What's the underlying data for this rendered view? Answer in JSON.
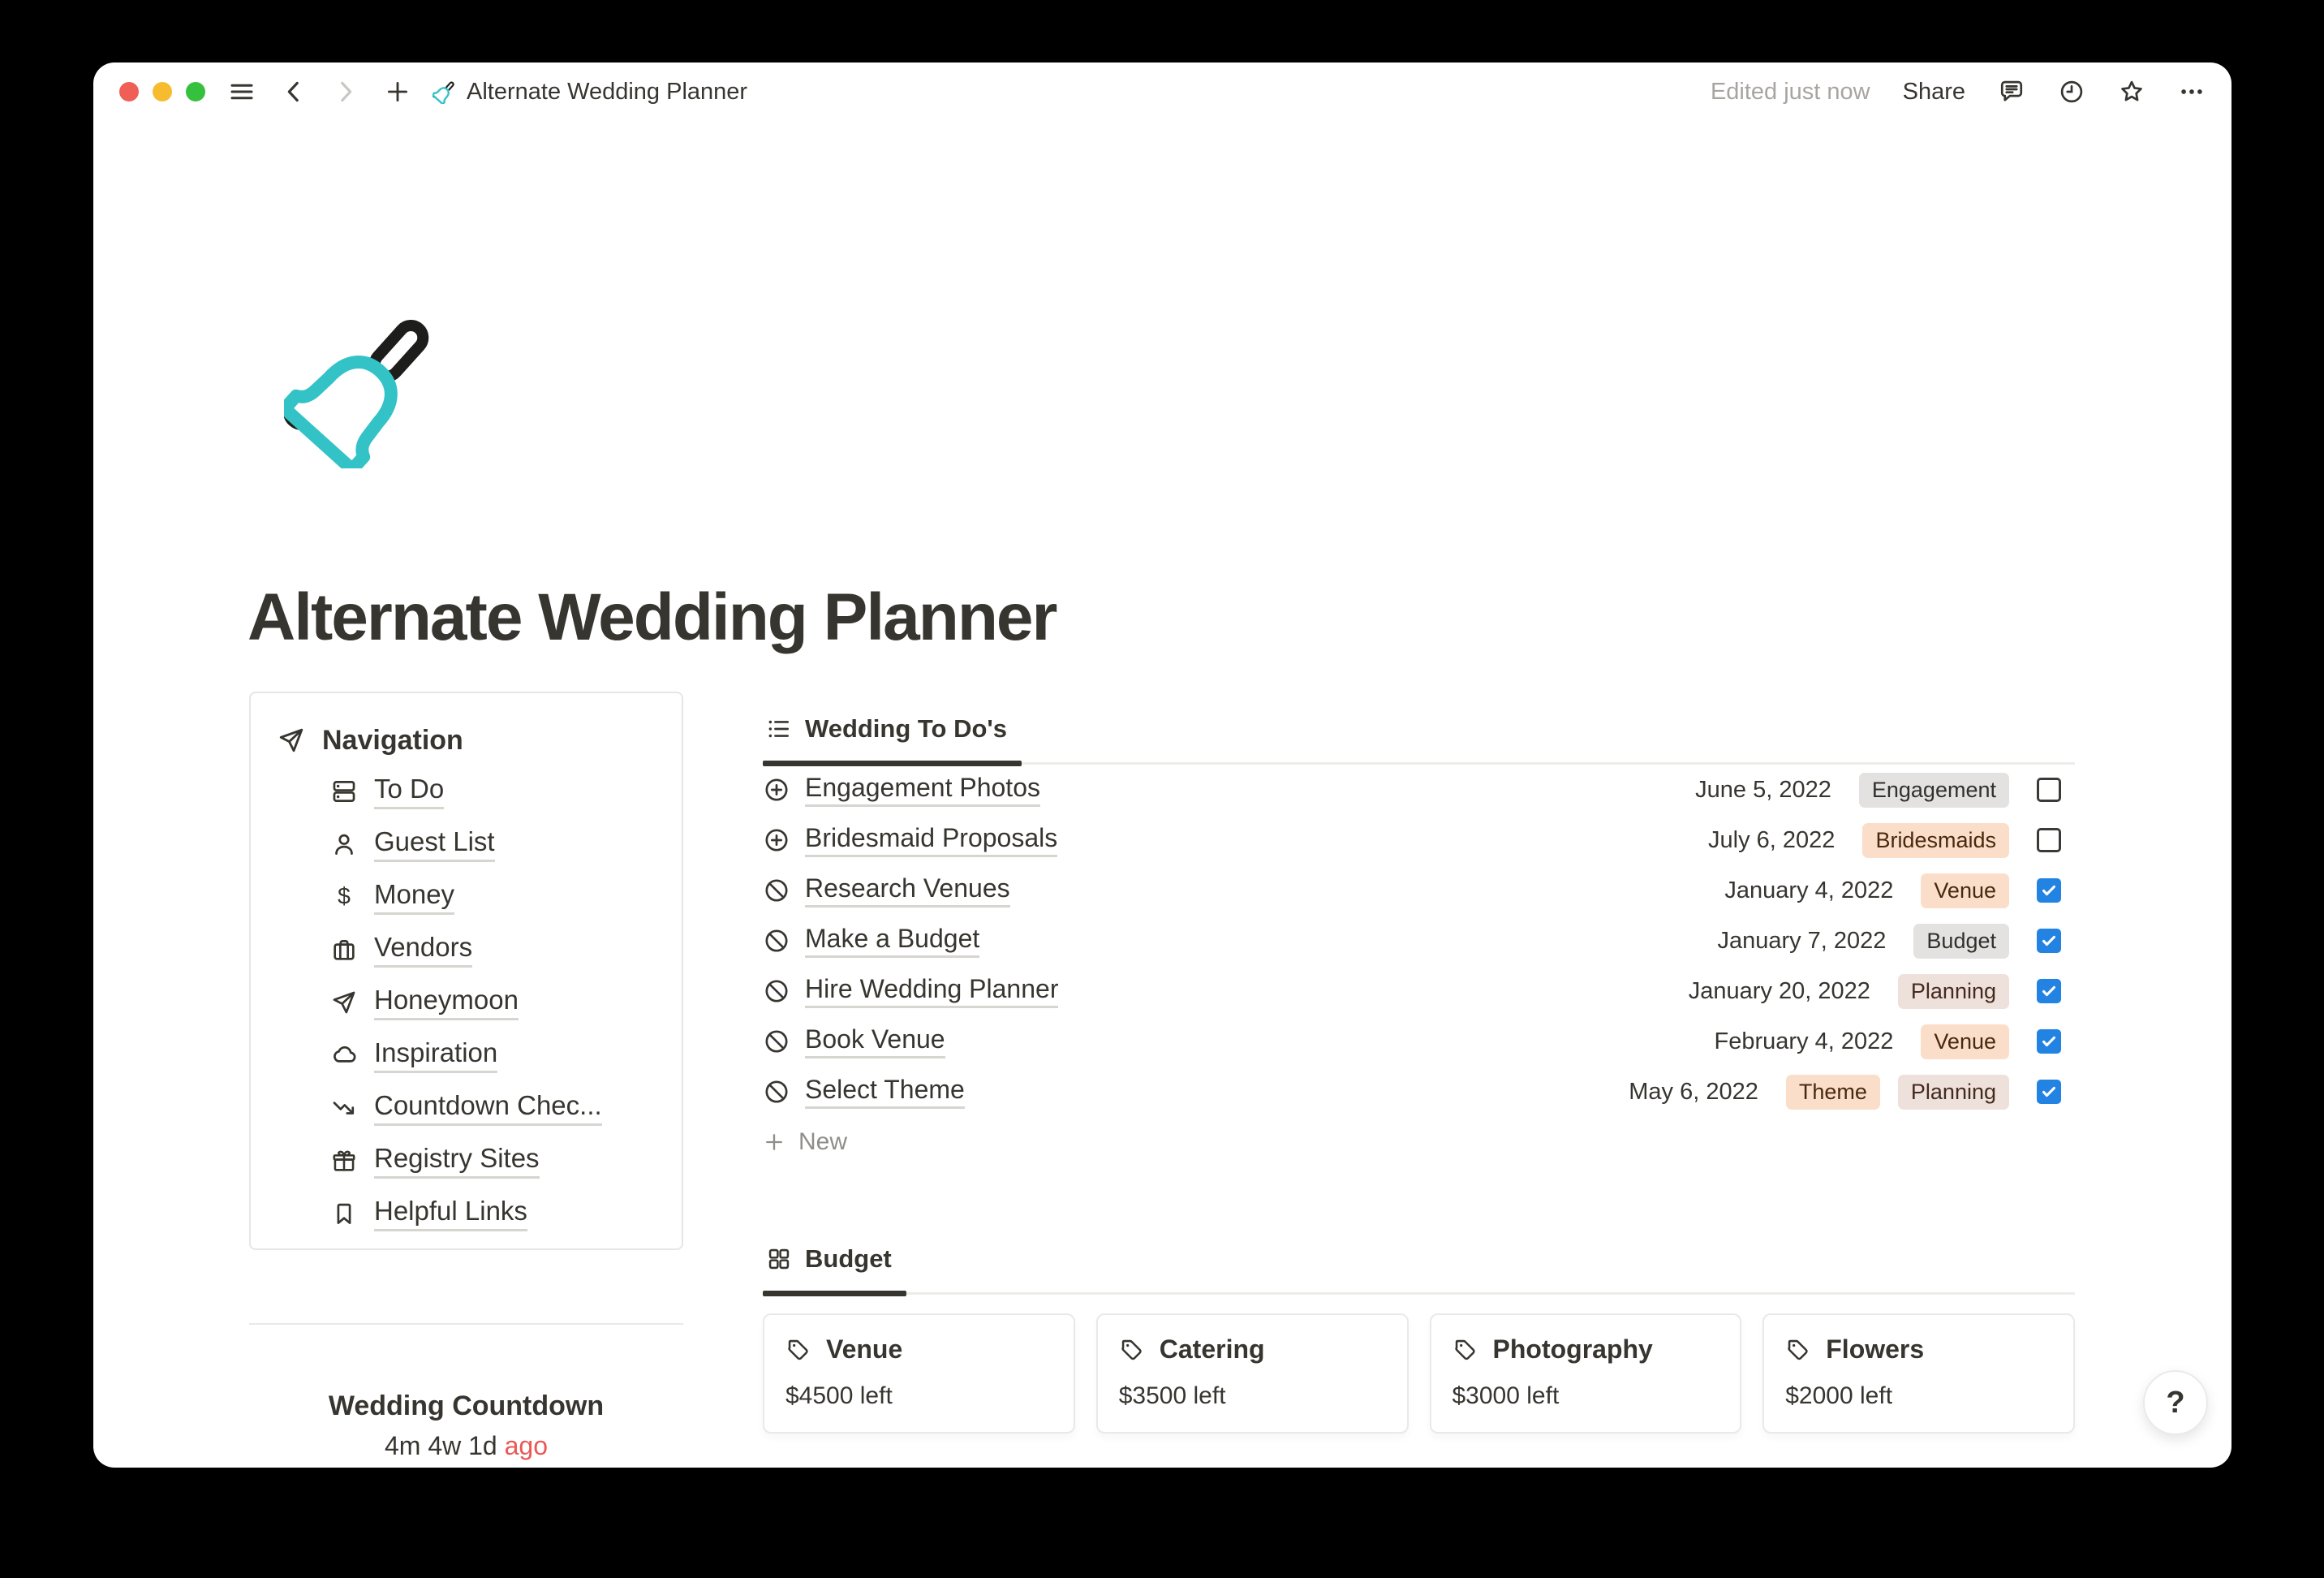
{
  "titlebar": {
    "title": "Alternate Wedding Planner",
    "edited_status": "Edited just now",
    "share_label": "Share"
  },
  "page": {
    "title": "Alternate Wedding Planner",
    "icon": "bell-icon"
  },
  "navigation": {
    "header": "Navigation",
    "items": [
      {
        "label": "To Do",
        "icon": "icon-rows"
      },
      {
        "label": "Guest List",
        "icon": "icon-person"
      },
      {
        "label": "Money",
        "icon": "icon-dollar"
      },
      {
        "label": "Vendors",
        "icon": "icon-briefcase"
      },
      {
        "label": "Honeymoon",
        "icon": "icon-send"
      },
      {
        "label": "Inspiration",
        "icon": "icon-cloud"
      },
      {
        "label": "Countdown Chec...",
        "icon": "icon-trend-down"
      },
      {
        "label": "Registry Sites",
        "icon": "icon-gift"
      },
      {
        "label": "Helpful Links",
        "icon": "icon-bookmark"
      }
    ]
  },
  "todo_section": {
    "tab_label": "Wedding To Do's",
    "new_label": "New",
    "rows": [
      {
        "icon": "icon-circle-plus",
        "title": "Engagement Photos",
        "date": "June 5, 2022",
        "tags": [
          {
            "label": "Engagement",
            "color": "gray"
          }
        ],
        "checked": false
      },
      {
        "icon": "icon-circle-plus",
        "title": "Bridesmaid Proposals",
        "date": "July 6, 2022",
        "tags": [
          {
            "label": "Bridesmaids",
            "color": "orange"
          }
        ],
        "checked": false
      },
      {
        "icon": "icon-circle-slash",
        "title": "Research Venues",
        "date": "January 4, 2022",
        "tags": [
          {
            "label": "Venue",
            "color": "orange"
          }
        ],
        "checked": true
      },
      {
        "icon": "icon-circle-slash",
        "title": "Make a Budget",
        "date": "January 7, 2022",
        "tags": [
          {
            "label": "Budget",
            "color": "gray"
          }
        ],
        "checked": true
      },
      {
        "icon": "icon-circle-slash",
        "title": "Hire Wedding Planner",
        "date": "January 20, 2022",
        "tags": [
          {
            "label": "Planning",
            "color": "brown"
          }
        ],
        "checked": true
      },
      {
        "icon": "icon-circle-slash",
        "title": "Book Venue",
        "date": "February 4, 2022",
        "tags": [
          {
            "label": "Venue",
            "color": "orange"
          }
        ],
        "checked": true
      },
      {
        "icon": "icon-circle-slash",
        "title": "Select Theme",
        "date": "May 6, 2022",
        "tags": [
          {
            "label": "Theme",
            "color": "orange"
          },
          {
            "label": "Planning",
            "color": "brown"
          }
        ],
        "checked": true
      }
    ]
  },
  "budget_section": {
    "tab_label": "Budget",
    "cards": [
      {
        "title": "Venue",
        "remaining": "$4500 left"
      },
      {
        "title": "Catering",
        "remaining": "$3500 left"
      },
      {
        "title": "Photography",
        "remaining": "$3000 left"
      },
      {
        "title": "Flowers",
        "remaining": "$2000 left"
      }
    ]
  },
  "countdown": {
    "title": "Wedding Countdown",
    "value": "4m 4w 1d",
    "suffix": "ago"
  },
  "help_label": "?",
  "colors": {
    "accent_teal": "#33C3C7",
    "checkbox_blue": "#2383E2",
    "ago_red": "#EB5757",
    "tag_gray_bg": "#E3E2E0",
    "tag_orange_bg": "#FADEC9",
    "tag_brown_bg": "#EEE0DA"
  }
}
